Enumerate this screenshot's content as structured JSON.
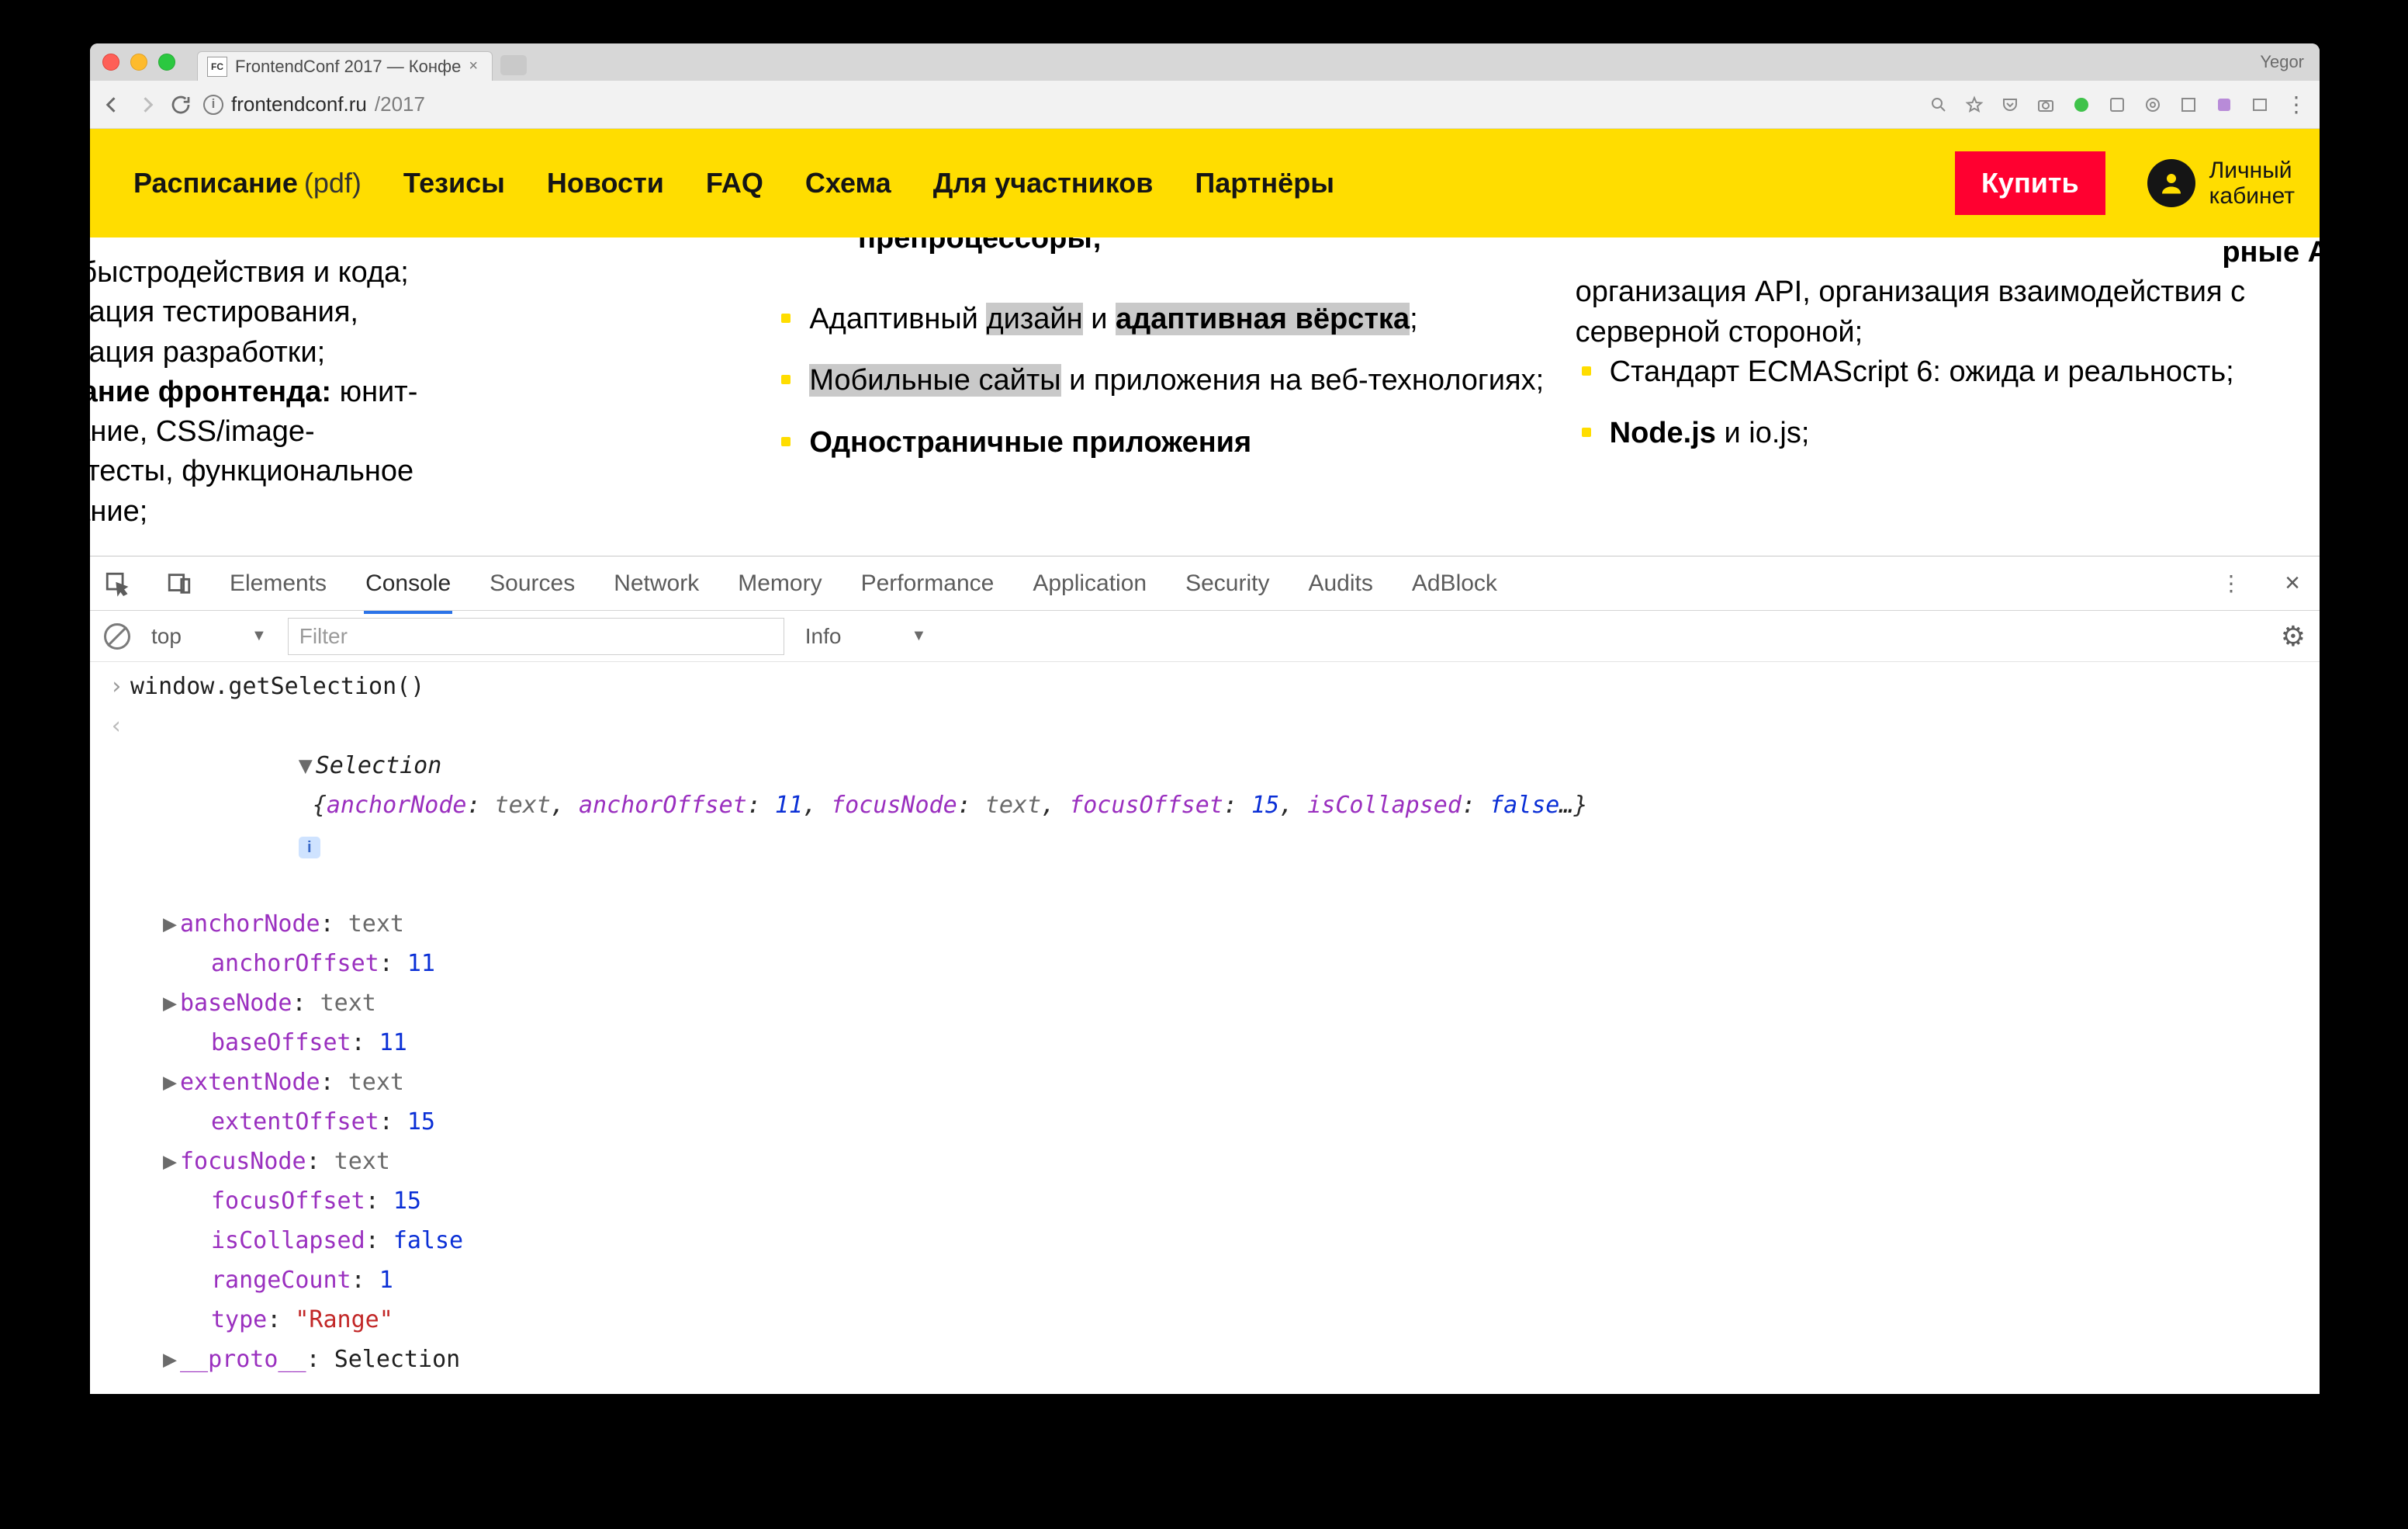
{
  "browser": {
    "profile": "Yegor",
    "tab": {
      "title": "FrontendConf 2017 — Конфе",
      "favicon": "FC"
    },
    "url": {
      "host": "frontendconf.ru",
      "path": "/2017"
    }
  },
  "nav": {
    "items": [
      {
        "label": "Расписание",
        "suffix": "(pdf)"
      },
      {
        "label": "Тезисы"
      },
      {
        "label": "Новости"
      },
      {
        "label": "FAQ"
      },
      {
        "label": "Схема"
      },
      {
        "label": "Для участников"
      },
      {
        "label": "Партнёры"
      }
    ],
    "buy": "Купить",
    "account_line1": "Личный",
    "account_line2": "кабинет"
  },
  "page": {
    "pre_col2": "препроцессоры;",
    "col1": {
      "frag1": "ерка быстродействия и кода;",
      "frag2": "матизация тестирования,",
      "frag3": "матизация разработки;",
      "h2": "ирование фронтенда:",
      "t2a": " юнит-",
      "t2b": "ирование, CSS/image-",
      "t2c": "ssion тесты, функциональное",
      "t2d": "ирование;"
    },
    "col2": {
      "li1_pre": "Адаптивный ",
      "li1_hl1": "дизайн",
      "li1_mid": " и ",
      "li1_hl2": "адаптивная вёрстка",
      "li1_post": ";",
      "li2_hl": "Мобильные сайты",
      "li2_rest": " и приложения на веб-технологиях;",
      "li3": "Одностраничные приложения"
    },
    "col3": {
      "frag_top1": "рные API",
      "frag_top2": "организация API, организация взаимодействия с серверной стороной;",
      "li1": "Стандарт ECMAScript 6: ожида     и реальность;",
      "li2_b": "Node.js",
      "li2_rest": " и io.js;"
    }
  },
  "devtools": {
    "tabs": [
      "Elements",
      "Console",
      "Sources",
      "Network",
      "Memory",
      "Performance",
      "Application",
      "Security",
      "Audits",
      "AdBlock"
    ],
    "active_tab": "Console",
    "context": "top",
    "filter_placeholder": "Filter",
    "level": "Info",
    "input_line": "window.getSelection()",
    "summary": {
      "type": "Selection",
      "props": [
        {
          "k": "anchorNode",
          "v": "text",
          "kind": "node"
        },
        {
          "k": "anchorOffset",
          "v": "11",
          "kind": "num"
        },
        {
          "k": "focusNode",
          "v": "text",
          "kind": "node"
        },
        {
          "k": "focusOffset",
          "v": "15",
          "kind": "num"
        },
        {
          "k": "isCollapsed",
          "v": "false",
          "kind": "num"
        }
      ],
      "ellipsis": "…"
    },
    "expanded": [
      {
        "k": "anchorNode",
        "v": "text",
        "kind": "node",
        "expandable": true
      },
      {
        "k": "anchorOffset",
        "v": "11",
        "kind": "num"
      },
      {
        "k": "baseNode",
        "v": "text",
        "kind": "node",
        "expandable": true
      },
      {
        "k": "baseOffset",
        "v": "11",
        "kind": "num"
      },
      {
        "k": "extentNode",
        "v": "text",
        "kind": "node",
        "expandable": true
      },
      {
        "k": "extentOffset",
        "v": "15",
        "kind": "num"
      },
      {
        "k": "focusNode",
        "v": "text",
        "kind": "node",
        "expandable": true
      },
      {
        "k": "focusOffset",
        "v": "15",
        "kind": "num"
      },
      {
        "k": "isCollapsed",
        "v": "false",
        "kind": "num"
      },
      {
        "k": "rangeCount",
        "v": "1",
        "kind": "num"
      },
      {
        "k": "type",
        "v": "\"Range\"",
        "kind": "str"
      }
    ],
    "proto_label": "__proto__",
    "proto_value": "Selection"
  }
}
